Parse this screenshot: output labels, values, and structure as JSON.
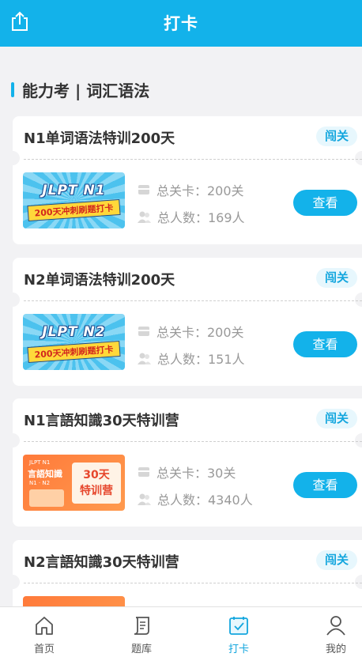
{
  "header": {
    "title": "打卡",
    "share_icon": "share-icon"
  },
  "section": {
    "title": "能力考 | 词汇语法",
    "accent": "#13b2ea"
  },
  "labels": {
    "levels": "总关卡：",
    "people": "总人数：",
    "view": "查看",
    "badge": "闯关"
  },
  "cards": [
    {
      "title": "N1单词语法特训200天",
      "badge": "闯关",
      "levels": "总关卡：200关",
      "people": "总人数：169人",
      "button": "查看",
      "thumb": {
        "style": "blue",
        "line1": "JLPT N1",
        "line2": "200天冲刺刷题打卡"
      }
    },
    {
      "title": "N2单词语法特训200天",
      "badge": "闯关",
      "levels": "总关卡：200关",
      "people": "总人数：151人",
      "button": "查看",
      "thumb": {
        "style": "blue",
        "line1": "JLPT N2",
        "line2": "200天冲刺刷题打卡"
      }
    },
    {
      "title": "N1言語知識30天特训营",
      "badge": "闯关",
      "levels": "总关卡：30关",
      "people": "总人数：4340人",
      "button": "查看",
      "thumb": {
        "style": "orange",
        "line1": "JLPT N1",
        "line2": "言語知識",
        "line3": "N1 · N2",
        "box": "30天\n特训营"
      }
    },
    {
      "title": "N2言語知識30天特训营",
      "badge": "闯关",
      "levels": "",
      "people": "",
      "button": "",
      "thumb": {
        "style": "orange",
        "line1": "",
        "line2": "",
        "line3": "",
        "box": ""
      }
    }
  ],
  "tabs": [
    {
      "label": "首页",
      "icon": "home-icon",
      "active": false
    },
    {
      "label": "题库",
      "icon": "question-bank-icon",
      "active": false
    },
    {
      "label": "打卡",
      "icon": "calendar-check-icon",
      "active": true
    },
    {
      "label": "我的",
      "icon": "user-icon",
      "active": false
    }
  ],
  "colors": {
    "brand": "#13b2ea",
    "badge_bg": "#e7f7fd",
    "text": "#333333",
    "muted": "#999999"
  }
}
